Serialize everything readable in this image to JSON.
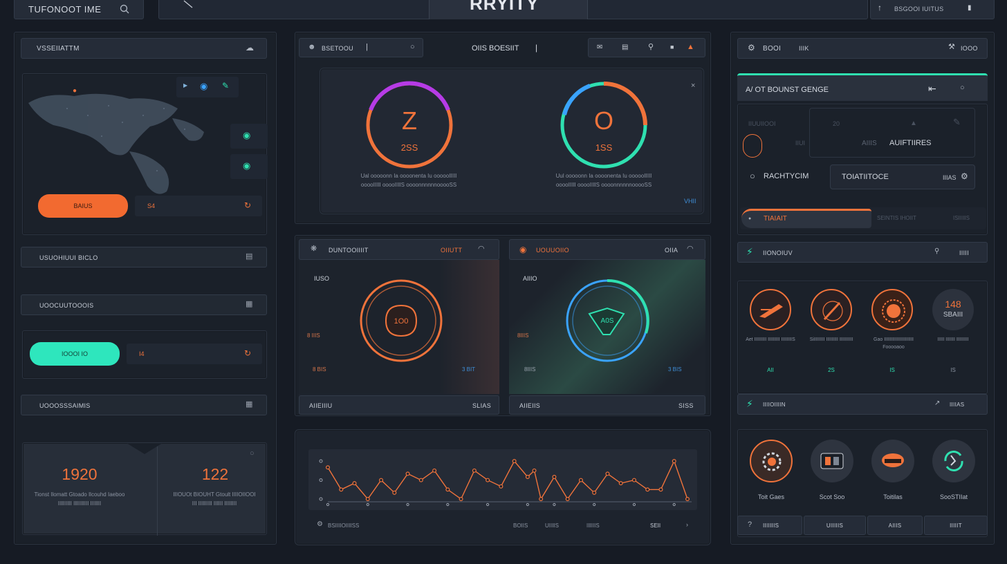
{
  "topbar": {
    "app_title": "TUFONOOT IME",
    "center_title": "RRYITY",
    "right_label": "BSGOOI IUITUS"
  },
  "left": {
    "header_label": "VSSEIIATTM",
    "map_value": "S4",
    "map_button": "BAIUS",
    "row1_label": "USUOHIUUI BICLO",
    "row2_label": "UOOCUUTOOOIS",
    "teal_button": "IOOOI IO",
    "teal_value": "I4",
    "row3_label": "UOOOSSSAIMIS",
    "stat1_value": "1920",
    "stat1_caption": "Tionst Ilomatt Gtoado Ilcouhd Iaeboo IIIIIIIII IIIIIIIIII IIIIIII",
    "stat2_value": "122",
    "stat2_caption": "IIIOUOt BIOUHT Gtoult IIIIOIIOOI III IIIIIIIII IIIIII IIIIIIII"
  },
  "center": {
    "tab_label": "BSETOOU",
    "title_label": "OIIS BOESIIT",
    "gauge1_letter": "Z",
    "gauge1_value": "2SS",
    "gauge1_caption": "Ual ooooonn Ia oooonenta Iu oooooIIIII ooooIIIII ooooIIIIS oooonnnnnnooooSS",
    "gauge2_letter": "O",
    "gauge2_value": "1SS",
    "gauge2_caption": "Uul ooooonn Ia oooonenta Iu oooooIIIII ooooIIIII ooooIIIIS oooonnnnnnooooSS",
    "corner_tag": "VHII",
    "mini1_title": "DUNTOOIIIIT",
    "mini1_right": "OIIUTT",
    "mini1_label": "IUSO",
    "mini1_value": "1O0",
    "mini1_side1": "8 IIIS",
    "mini1_side2": "8 BIS",
    "mini1_side3": "3 BIT",
    "mini1_footer": "AIIEIIIU",
    "mini1_footer_right": "SLIAS",
    "mini2_title": "UOUUOIIO",
    "mini2_right": "OIIA",
    "mini2_label": "AIIIO",
    "mini2_value": "A0S",
    "mini2_side1": "8IIIS",
    "mini2_side2": "8IIIS",
    "mini2_side3": "3 BIS",
    "mini2_footer": "AIIEIIS",
    "mini2_footer_right": "SISS",
    "chart_footer": [
      "BSIIIIOIIIISS",
      "BOIIS",
      "UIIIIS",
      "IIIIIIS",
      "SEII"
    ]
  },
  "right": {
    "header_left": "BOOI",
    "header_mid": "IIIK",
    "header_right": "IOOO",
    "band_title": "A/ OT BOUNST GENGE",
    "ghost1": "IIUUIIOOI",
    "ghost2": "20",
    "ghost3": "IIUI",
    "ghost4": "AIIIS",
    "feature": "AUIFTIIRES",
    "radio_label": "RACHTYCIM",
    "box_label": "TOIATIITOCE",
    "box_right": "IIIAS",
    "tab_active": "TIAIAIT",
    "tab_ghost1": "SEINTIS IHOIIT",
    "tab_ghost2": "ISIIIIIS",
    "row1_label": "IIONOIUV",
    "row1_right": "IIIII",
    "circle4_value": "148",
    "circle4_sub": "SBAIII",
    "circles": [
      {
        "caption": "Aet IIIIIIIII IIIIIIIII IIIIIIIIS",
        "value": "AII"
      },
      {
        "caption": "SiIIIIIIII IIIIIIIII IIIIIIIIII",
        "value": "2S"
      },
      {
        "caption": "Gao IIIIIIIIIIIIIIIIIIIIII Fooooaoo",
        "value": "IS"
      },
      {
        "caption": "IIIII IIIIIII IIIIIIIII",
        "value": "IS"
      }
    ],
    "row2_label": "IIIIOIIIIN",
    "row2_right": "IIIIAS",
    "icons": [
      {
        "caption": "Toit Gaes"
      },
      {
        "caption": "Scot Soo"
      },
      {
        "caption": "Toitilas"
      },
      {
        "caption": "SooSTIIat"
      }
    ],
    "footer": [
      "IIIIIIIS",
      "UIIIIIS",
      "AIIIS",
      "IIIIIT"
    ]
  },
  "chart_data": {
    "type": "line",
    "title": "",
    "x": [
      1,
      2,
      3,
      4,
      5,
      6,
      7,
      8,
      9,
      10,
      11,
      12,
      13,
      14,
      15,
      16,
      16.5,
      17,
      18,
      19,
      20,
      21,
      22,
      23,
      24,
      25,
      26,
      27,
      28
    ],
    "y": [
      10,
      3,
      5,
      0,
      6,
      2,
      8,
      6,
      9,
      3,
      0,
      9,
      6,
      4,
      12,
      7,
      9,
      0,
      7,
      0,
      6,
      2,
      8,
      5,
      6,
      3,
      3,
      12,
      0
    ],
    "ylim": [
      0,
      14
    ],
    "grid": false,
    "color": "#f0733b"
  },
  "colors": {
    "accent_orange": "#f0733b",
    "accent_teal": "#2fe0b0",
    "accent_purple": "#b63be6",
    "background": "#161b24"
  }
}
